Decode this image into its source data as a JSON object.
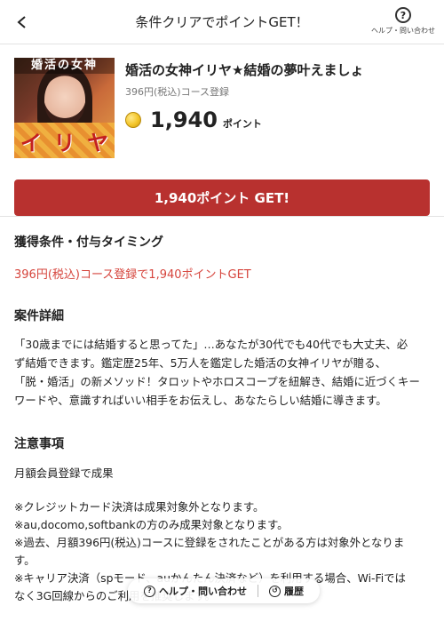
{
  "header": {
    "title": "条件クリアでポイントGET！",
    "help_label": "ヘルプ・問い合わせ",
    "help_icon": "question-circle-icon",
    "back_icon": "chevron-left-icon"
  },
  "offer": {
    "thumbnail_label": "婚活の女神",
    "thumbnail_name": [
      "イ",
      "リ",
      "ヤ"
    ],
    "title": "婚活の女神イリヤ★結婚の夢叶えましょ",
    "subtitle": "396円(税込)コース登録",
    "points": "1,940",
    "points_unit": "ポイント",
    "coin_icon": "coin-icon"
  },
  "get_button": {
    "label": "1,940ポイント GET!"
  },
  "conditions": {
    "title": "獲得条件・付与タイミング",
    "text": "396円(税込)コース登録で1,940ポイントGET"
  },
  "details": {
    "title": "案件詳細",
    "lines": [
      "「30歳までには結婚すると思ってた」…あなたが30代でも40代でも大丈夫、必",
      "ず結婚できます。鑑定歴25年、5万人を鑑定した婚活の女神イリヤが贈る、",
      "「脱・婚活」の新メソッド！タロットやホロスコープを紐解き、結婚に近づくキー",
      "ワードや、意識すればいい相手をお伝えし、あなたらしい結婚に導きます。"
    ]
  },
  "notes": {
    "title": "注意事項",
    "first": "月額会員登録で成果",
    "lines": [
      "※クレジットカード決済は成果対象外となります。",
      "※au,docomo,softbankの方のみ成果対象となります。",
      "※過去、月額396円(税込)コースに登録をされたことがある方は対象外となりま",
      "す。",
      "※キャリア決済（spモード、auかんたん決済など）を利用する場合、Wi-Fiでは",
      "なく3G回線からのご利用を推奨します。"
    ]
  },
  "bottom_bar": {
    "help_label": "ヘルプ・問い合わせ",
    "history_label": "履歴"
  },
  "colors": {
    "accent": "#b8312f",
    "condition_text": "#d6453d"
  }
}
